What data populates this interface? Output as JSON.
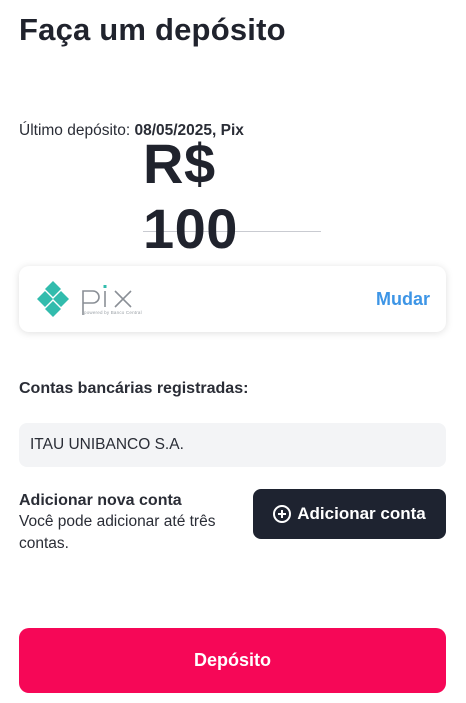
{
  "page": {
    "title": "Faça um depósito"
  },
  "last_deposit": {
    "label": "Último depósito:",
    "value": "08/05/2025, Pix"
  },
  "amount": {
    "display": "R$ 100"
  },
  "payment_method": {
    "name": "pix",
    "subtitle": "powered by Banco Central",
    "change_label": "Mudar",
    "brand_color": "#32bcad"
  },
  "bank_accounts": {
    "label": "Contas bancárias registradas:",
    "items": [
      {
        "name": "ITAU UNIBANCO S.A."
      }
    ]
  },
  "add_account": {
    "title": "Adicionar nova conta",
    "description": "Você pode adicionar até três contas.",
    "button_label": "Adicionar conta",
    "button_icon": "plus-circle-icon"
  },
  "deposit_button": {
    "label": "Depósito",
    "color": "#f60757"
  }
}
